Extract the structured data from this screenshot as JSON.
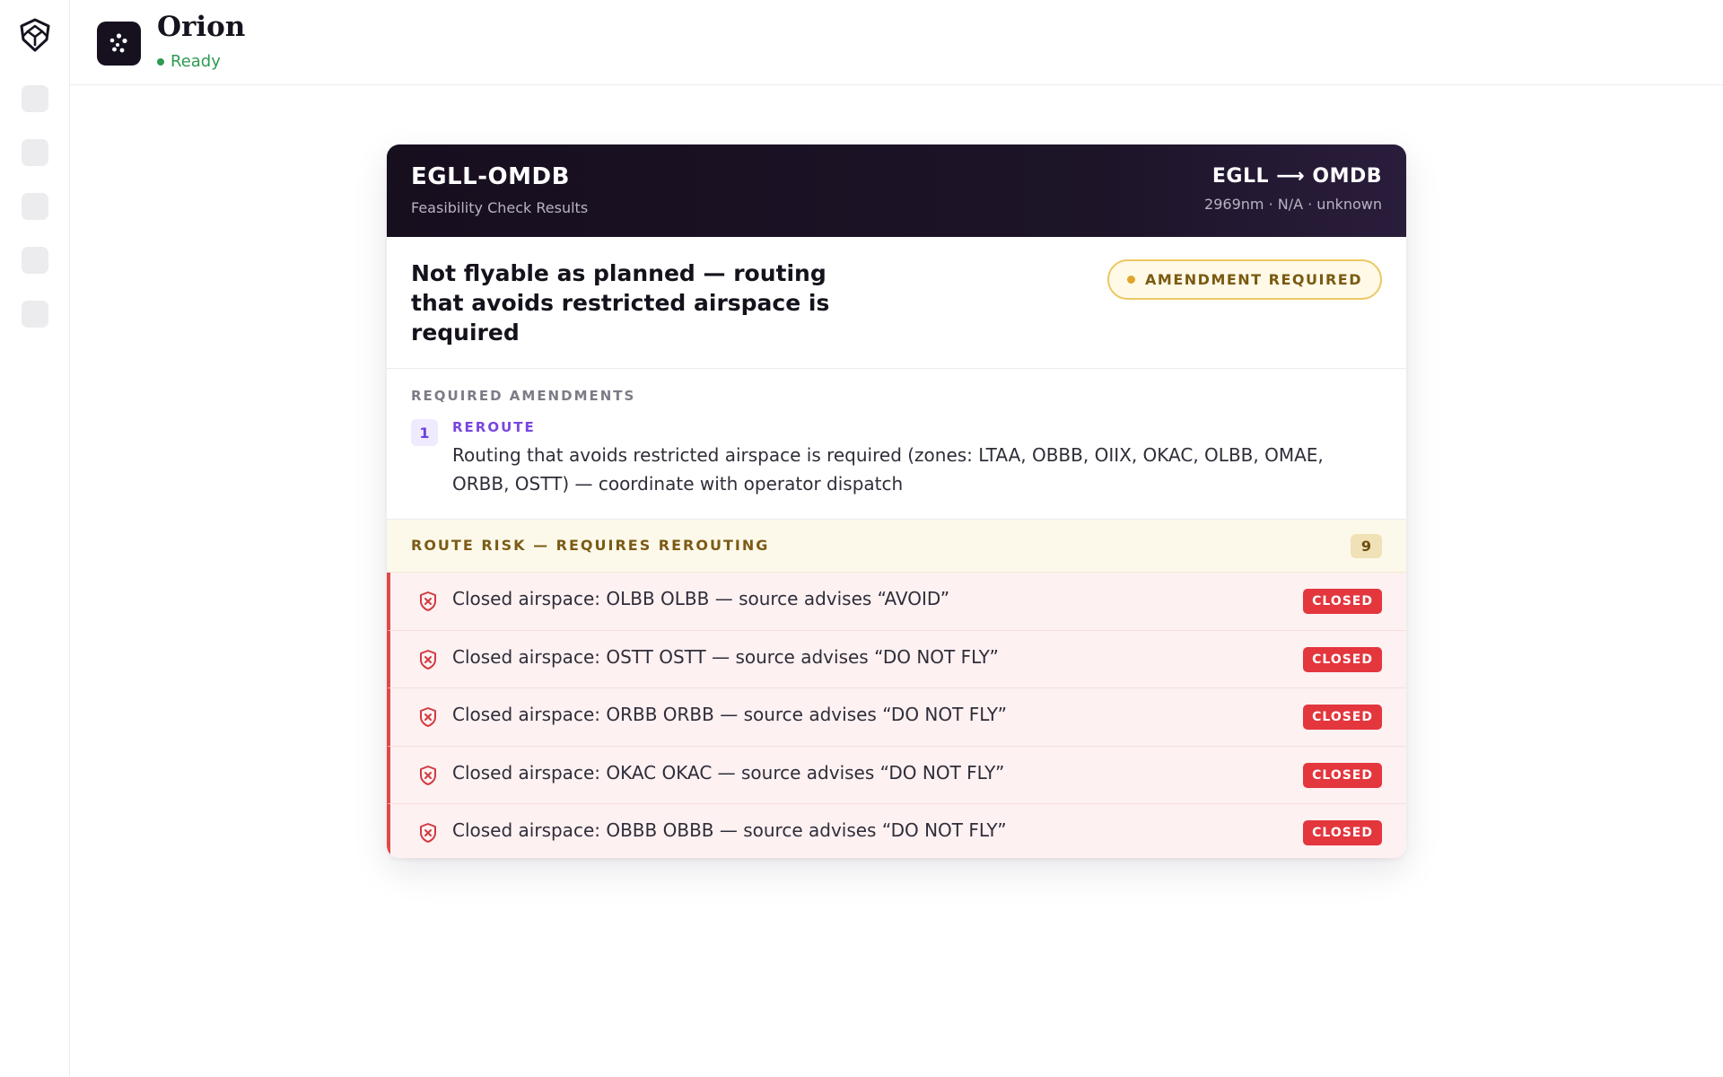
{
  "sidebar": {
    "logo_icon": "shield-logo-icon",
    "slots": 5
  },
  "app": {
    "title": "Orion",
    "status": "Ready",
    "icon": "sparkle-dots-icon"
  },
  "card": {
    "title": "EGLL-OMDB",
    "subtitle": "Feasibility Check Results",
    "route": "EGLL ⟶ OMDB",
    "meta": "2969nm · N/A · unknown",
    "verdict": "Not flyable as planned — routing that avoids restricted airspace is required",
    "badge": "AMENDMENT REQUIRED",
    "amendments_heading": "REQUIRED AMENDMENTS",
    "amendments": [
      {
        "number": "1",
        "type": "REROUTE",
        "description": "Routing that avoids restricted airspace is required (zones: LTAA, OBBB, OIIX, OKAC, OLBB, OMAE, ORBB, OSTT) — coordinate with operator dispatch"
      }
    ],
    "risk": {
      "title": "ROUTE RISK — REQUIRES REROUTING",
      "count": "9",
      "items": [
        {
          "text": "Closed airspace: OLBB OLBB — source advises “AVOID”",
          "badge": "CLOSED",
          "icon": "shield-x-icon"
        },
        {
          "text": "Closed airspace: OSTT OSTT — source advises “DO NOT FLY”",
          "badge": "CLOSED",
          "icon": "shield-x-icon"
        },
        {
          "text": "Closed airspace: ORBB ORBB — source advises “DO NOT FLY”",
          "badge": "CLOSED",
          "icon": "shield-x-icon"
        },
        {
          "text": "Closed airspace: OKAC OKAC — source advises “DO NOT FLY”",
          "badge": "CLOSED",
          "icon": "shield-x-icon"
        },
        {
          "text": "Closed airspace: OBBB OBBB — source advises “DO NOT FLY”",
          "badge": "CLOSED",
          "icon": "shield-x-icon"
        }
      ]
    }
  },
  "colors": {
    "header_bg": "#170e1e",
    "status_green": "#2e9a52",
    "amber": "#e0a62a",
    "danger_red": "#e3363d",
    "purple": "#7a45e0"
  }
}
